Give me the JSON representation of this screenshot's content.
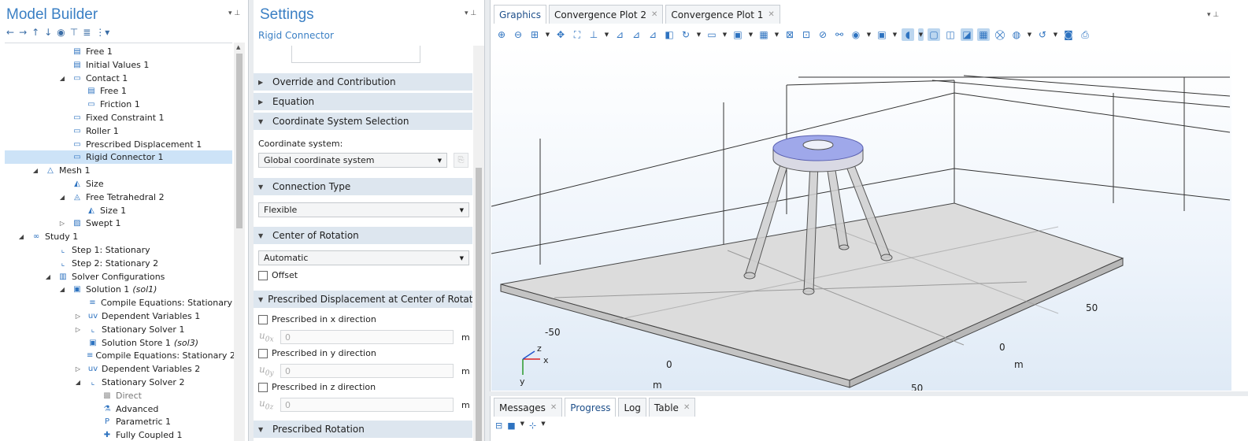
{
  "model_builder": {
    "title": "Model Builder",
    "tree": [
      {
        "label": "Free 1",
        "icon": "free-icon",
        "indent": 96,
        "arrow": ""
      },
      {
        "label": "Initial Values 1",
        "icon": "initial-values-icon",
        "indent": 96,
        "arrow": ""
      },
      {
        "label": "Contact 1",
        "icon": "contact-icon",
        "indent": 96,
        "arrow": "expanded"
      },
      {
        "label": "Free 1",
        "icon": "free-icon",
        "indent": 114,
        "arrow": ""
      },
      {
        "label": "Friction 1",
        "icon": "friction-icon",
        "indent": 114,
        "arrow": ""
      },
      {
        "label": "Fixed Constraint 1",
        "icon": "fixed-constraint-icon",
        "indent": 96,
        "arrow": ""
      },
      {
        "label": "Roller 1",
        "icon": "roller-icon",
        "indent": 96,
        "arrow": ""
      },
      {
        "label": "Prescribed Displacement 1",
        "icon": "prescribed-displacement-icon",
        "indent": 96,
        "arrow": ""
      },
      {
        "label": "Rigid Connector 1",
        "icon": "rigid-connector-icon",
        "indent": 96,
        "arrow": "",
        "selected": true
      },
      {
        "label": "Mesh 1",
        "icon": "mesh-icon",
        "indent": 62,
        "arrow": "expanded"
      },
      {
        "label": "Size",
        "icon": "size-icon",
        "indent": 96,
        "arrow": ""
      },
      {
        "label": "Free Tetrahedral 2",
        "icon": "free-tetrahedral-icon",
        "indent": 96,
        "arrow": "expanded"
      },
      {
        "label": "Size 1",
        "icon": "size-icon",
        "indent": 114,
        "arrow": ""
      },
      {
        "label": "Swept 1",
        "icon": "swept-icon",
        "indent": 96,
        "arrow": "collapsed"
      },
      {
        "label": "Study 1",
        "icon": "study-icon",
        "indent": 44,
        "arrow": "expanded"
      },
      {
        "label": "Step 1: Stationary",
        "icon": "stationary-step-icon",
        "indent": 78,
        "arrow": ""
      },
      {
        "label": "Step 2: Stationary 2",
        "icon": "stationary-step-icon",
        "indent": 78,
        "arrow": ""
      },
      {
        "label": "Solver Configurations",
        "icon": "solver-configurations-icon",
        "indent": 78,
        "arrow": "expanded"
      },
      {
        "label": "Solution 1",
        "label_italic": "(sol1)",
        "icon": "solution-icon",
        "indent": 96,
        "arrow": "expanded"
      },
      {
        "label": "Compile Equations: Stationary",
        "icon": "compile-equations-icon",
        "indent": 116,
        "arrow": ""
      },
      {
        "label": "Dependent Variables 1",
        "icon": "dependent-variables-icon",
        "indent": 116,
        "arrow": "collapsed"
      },
      {
        "label": "Stationary Solver 1",
        "icon": "stationary-solver-icon",
        "indent": 116,
        "arrow": "collapsed"
      },
      {
        "label": "Solution Store 1",
        "label_italic": "(sol3)",
        "icon": "solution-store-icon",
        "indent": 116,
        "arrow": ""
      },
      {
        "label": "Compile Equations: Stationary 2",
        "icon": "compile-equations-icon",
        "indent": 116,
        "arrow": ""
      },
      {
        "label": "Dependent Variables 2",
        "icon": "dependent-variables-icon",
        "indent": 116,
        "arrow": "collapsed"
      },
      {
        "label": "Stationary Solver 2",
        "icon": "stationary-solver-icon",
        "indent": 116,
        "arrow": "expanded"
      },
      {
        "label": "Direct",
        "icon": "direct-icon",
        "indent": 134,
        "arrow": "",
        "disabled": true
      },
      {
        "label": "Advanced",
        "icon": "advanced-icon",
        "indent": 134,
        "arrow": ""
      },
      {
        "label": "Parametric 1",
        "icon": "parametric-icon",
        "indent": 134,
        "arrow": ""
      },
      {
        "label": "Fully Coupled 1",
        "icon": "fully-coupled-icon",
        "indent": 134,
        "arrow": ""
      }
    ]
  },
  "settings": {
    "title": "Settings",
    "subtitle": "Rigid Connector",
    "sections": {
      "override": "Override and Contribution",
      "equation": "Equation",
      "coord_sel": "Coordinate System Selection",
      "connection": "Connection Type",
      "center": "Center of Rotation",
      "presc_disp": "Prescribed Displacement at Center of Rotation",
      "presc_rot": "Prescribed Rotation"
    },
    "coord_label": "Coordinate system:",
    "coord_value": "Global coordinate system",
    "connection_value": "Flexible",
    "center_value": "Automatic",
    "offset_label": "Offset",
    "presc_x": "Prescribed in x direction",
    "presc_y": "Prescribed in y direction",
    "presc_z": "Prescribed in z direction",
    "u0x_var": "u",
    "u0x_sub": "0x",
    "u0y_var": "u",
    "u0y_sub": "0y",
    "u0z_var": "u",
    "u0z_sub": "0z",
    "u0x_value": "0",
    "u0y_value": "0",
    "u0z_value": "0",
    "unit": "m"
  },
  "graphics": {
    "tabs": [
      {
        "label": "Graphics",
        "active": true,
        "closable": false
      },
      {
        "label": "Convergence Plot 2",
        "active": false,
        "closable": true
      },
      {
        "label": "Convergence Plot 1",
        "active": false,
        "closable": true
      }
    ],
    "ticks": {
      "neg50": "-50",
      "zero_x": "0",
      "m_x": "m",
      "fifty_y": "50",
      "zero_y": "0",
      "m_y": "m",
      "fifty_bottom": "50"
    },
    "triad": {
      "x": "x",
      "y": "y",
      "z": "z"
    }
  },
  "messages": {
    "tabs": [
      {
        "label": "Messages",
        "active": false,
        "closable": true
      },
      {
        "label": "Progress",
        "active": true,
        "closable": false
      },
      {
        "label": "Log",
        "active": false,
        "closable": false
      },
      {
        "label": "Table",
        "active": false,
        "closable": true
      }
    ]
  },
  "colors": {
    "accent": "#3a7fc4",
    "selection": "#cde3f7",
    "section_bg": "#dde6ef",
    "ring_highlight": "#9fa8ea"
  }
}
